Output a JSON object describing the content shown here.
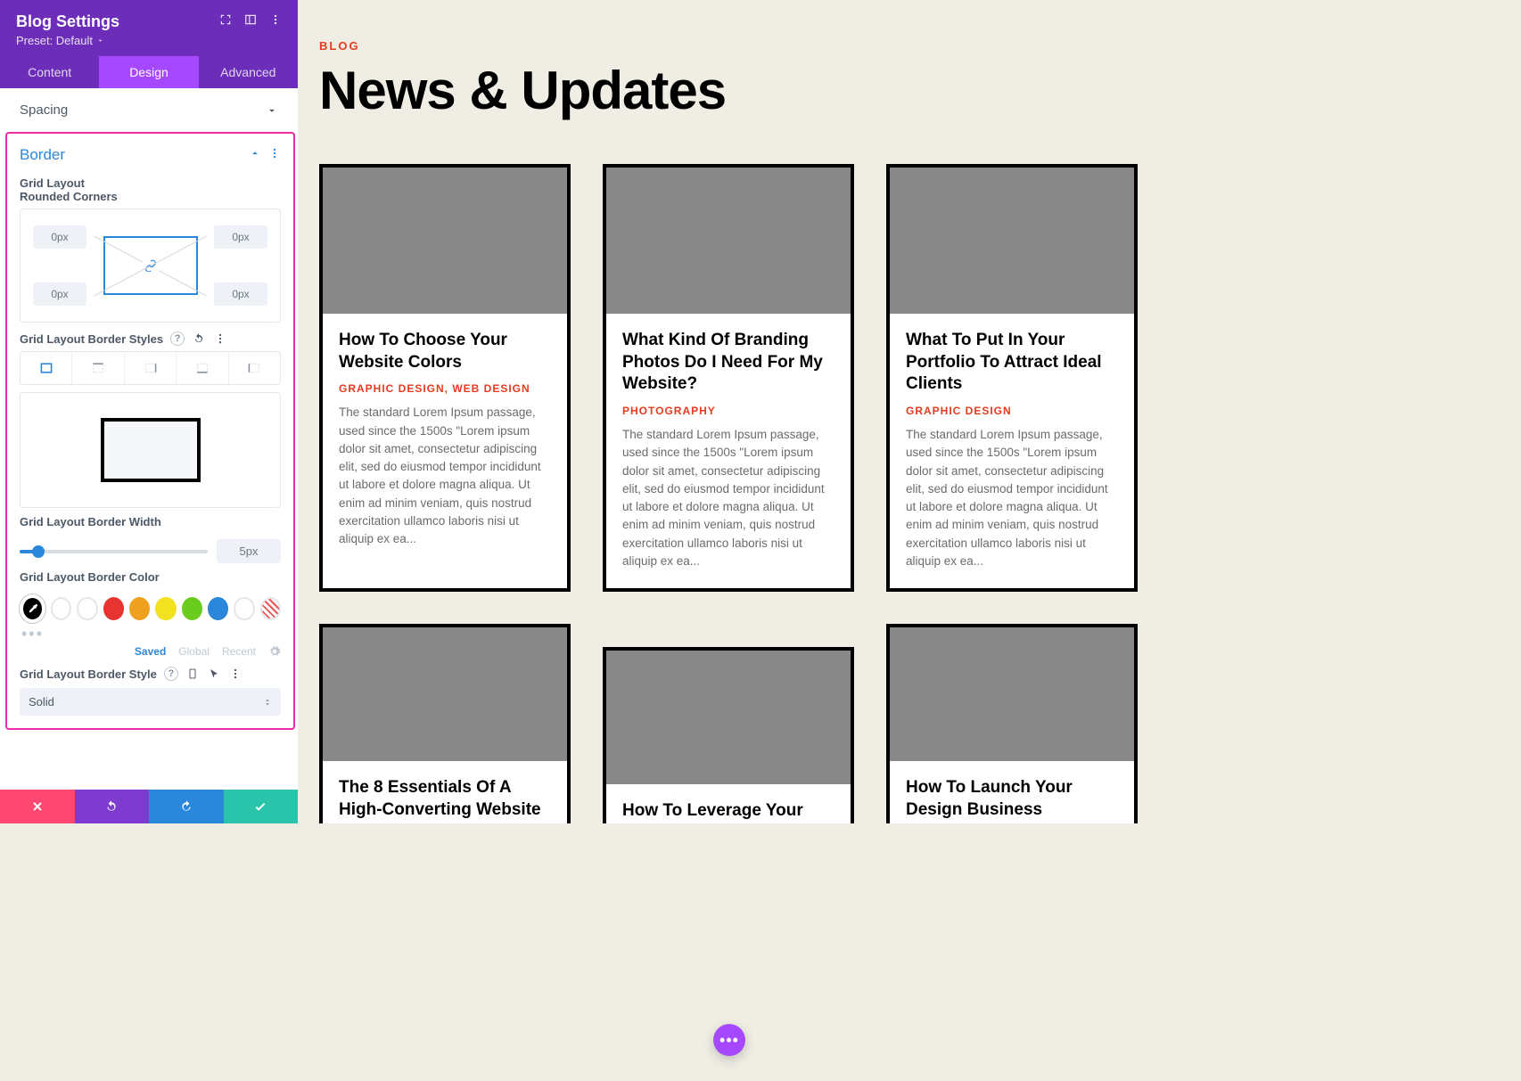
{
  "sidebar": {
    "title": "Blog Settings",
    "preset": "Preset: Default",
    "tabs": [
      "Content",
      "Design",
      "Advanced"
    ],
    "activeTab": 1,
    "spacing_label": "Spacing",
    "border": {
      "title": "Border",
      "rounded_label": "Grid Layout Rounded Corners",
      "corner_tl": "0px",
      "corner_tr": "0px",
      "corner_bl": "0px",
      "corner_br": "0px",
      "styles_label": "Grid Layout Border Styles",
      "width_label": "Grid Layout Border Width",
      "width_value": "5px",
      "color_label": "Grid Layout Border Color",
      "palette_tabs": [
        "Saved",
        "Global",
        "Recent"
      ],
      "style_label": "Grid Layout Border Style",
      "style_value": "Solid"
    },
    "colors": {
      "swatches": [
        "#000000",
        "#ffffff",
        "#ffffff",
        "#e63531",
        "#f0a01f",
        "#f2e21f",
        "#6acc1f",
        "#2b87da",
        "#ffffff"
      ]
    }
  },
  "page": {
    "eyebrow": "BLOG",
    "headline": "News & Updates",
    "lorem": "The standard Lorem Ipsum passage, used since the 1500s \"Lorem ipsum dolor sit amet, consectetur adipiscing elit, sed do eiusmod tempor incididunt ut labore et dolore magna aliqua. Ut enim ad minim veniam, quis nostrud exercitation ullamco laboris nisi ut aliquip ex ea...",
    "lorem2": "The standard Lorem Ipsum passage, used since the 1500s \"Lorem ipsum dolor sit amet, consectetur adipiscing elit, sed do eiusmod tempor incididunt ut labore et dolore magna aliqua. Ut enim ad minim veniam, quis nostrud exercitation ullamco laboris nisi ut aliquip ex ea...",
    "posts": [
      {
        "title": "How To Choose Your Website Colors",
        "cat": "GRAPHIC DESIGN, WEB DESIGN"
      },
      {
        "title": "What Kind Of Branding Photos Do I Need For My Website?",
        "cat": "PHOTOGRAPHY"
      },
      {
        "title": "What To Put In Your Portfolio To Attract Ideal Clients",
        "cat": "GRAPHIC DESIGN"
      },
      {
        "title": "The 8 Essentials Of A High-Converting Website",
        "cat": ""
      },
      {
        "title": "How To Leverage Your",
        "cat": ""
      },
      {
        "title": "How To Launch Your Design Business",
        "cat": ""
      }
    ]
  }
}
